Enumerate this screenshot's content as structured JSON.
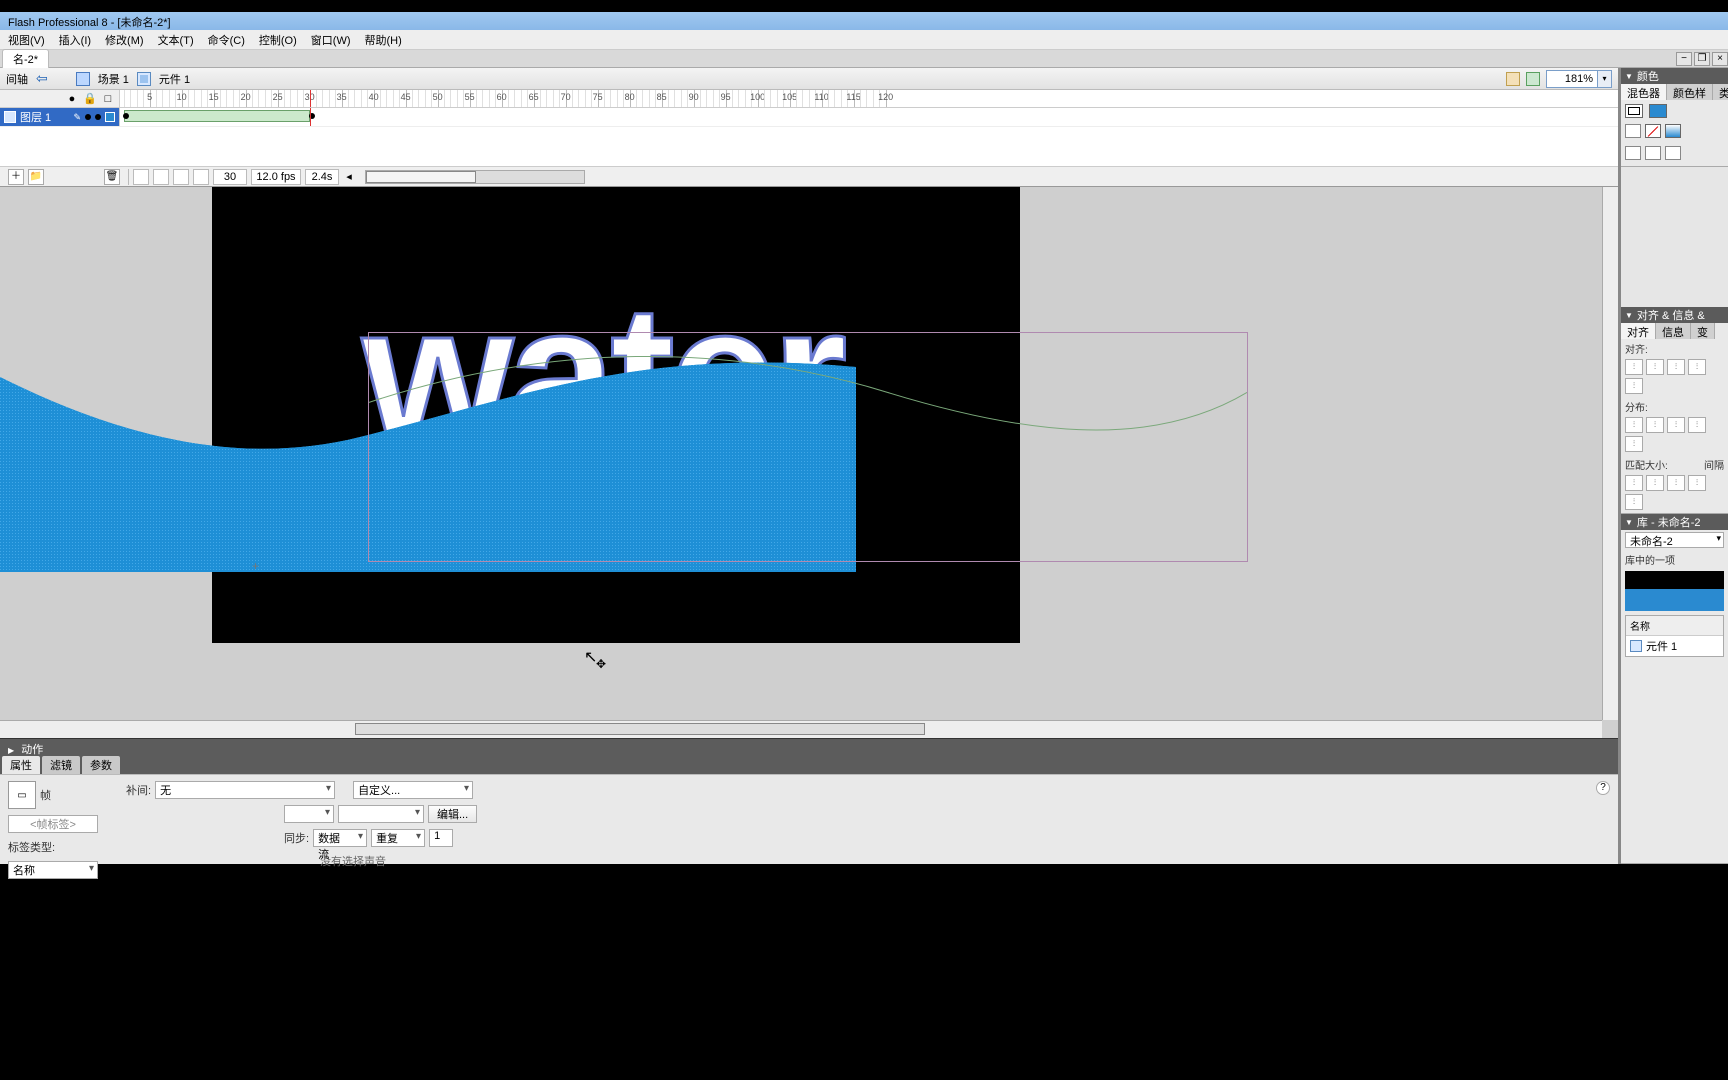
{
  "window": {
    "title": "Flash Professional 8 - [未命名-2*]"
  },
  "menu": {
    "view": "视图(V)",
    "insert": "插入(I)",
    "modify": "修改(M)",
    "text": "文本(T)",
    "commands": "命令(C)",
    "control": "控制(O)",
    "window": "窗口(W)",
    "help": "帮助(H)"
  },
  "document": {
    "tab": "名-2*",
    "timeline_label": "间轴",
    "back_arrow": "⇦",
    "scene_label": "场景 1",
    "symbol_label": "元件 1"
  },
  "zoom": {
    "value": "181%"
  },
  "timeline": {
    "layer_name": "图层 1",
    "current_frame": "30",
    "fps": "12.0 fps",
    "elapsed": "2.4s",
    "ruler_max": 120,
    "playhead_frame": 30,
    "tween_start": 1,
    "tween_end": 30
  },
  "canvas": {
    "text": "water"
  },
  "actions_panel": {
    "title": "动作"
  },
  "property_tabs": {
    "properties": "属性",
    "filters": "滤镜",
    "params": "参数"
  },
  "properties": {
    "frame_icon_label": "帧",
    "frame_label_placeholder": "<帧标签>",
    "label_type_label": "标签类型:",
    "label_type_value": "名称",
    "tween_label": "补间:",
    "tween_value": "无",
    "sound_label": "",
    "custom_btn": "自定义...",
    "edit_btn": "编辑...",
    "sync_label": "同步:",
    "sync_value": "数据流",
    "repeat_value": "重复",
    "repeat_count": "1",
    "no_sound": "没有选择声音"
  },
  "panels": {
    "color_title": "颜色",
    "mixer_tab": "混色器",
    "swatch_tab": "颜色样",
    "type_tab": "类",
    "align_title": "对齐 & 信息 &",
    "align_tab": "对齐",
    "info_tab": "信息",
    "trans_tab": "变",
    "align_label": "对齐:",
    "distribute_label": "分布:",
    "matchsize_label": "匹配大小:",
    "space_label": "间隔",
    "library_title": "库 - 未命名-2",
    "library_doc": "未命名-2",
    "library_count": "库中的一项",
    "name_header": "名称",
    "item1": "元件 1"
  }
}
